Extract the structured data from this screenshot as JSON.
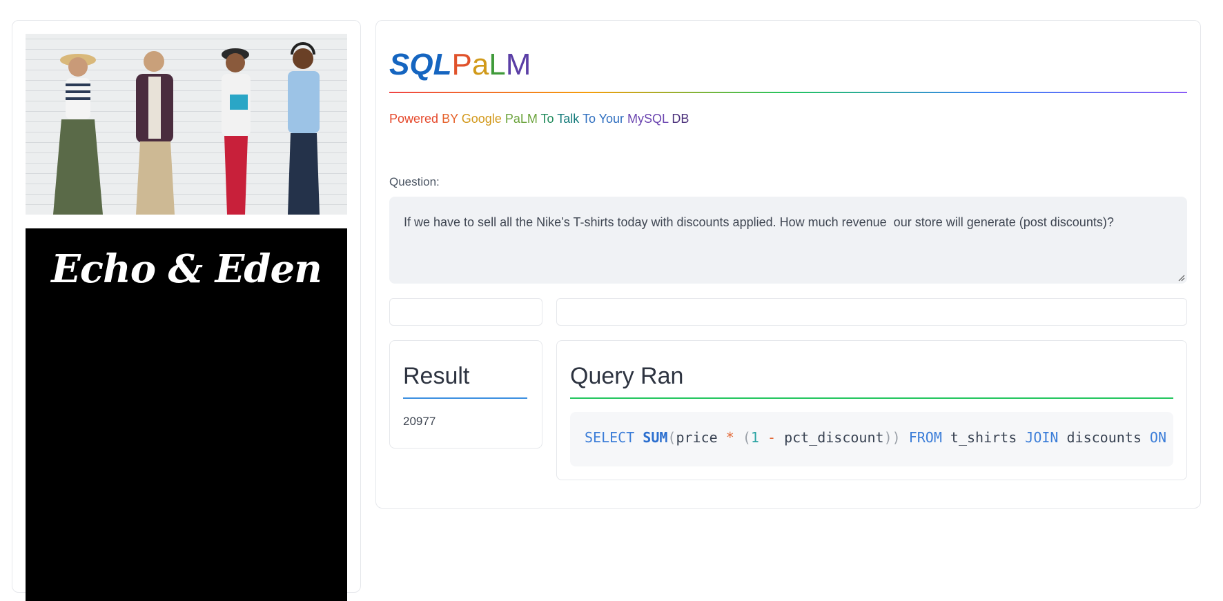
{
  "sidebar": {
    "photo_alt": "group-of-people-with-phones",
    "brand_name": "Echo & Eden"
  },
  "header": {
    "title_part1": "SQL",
    "title_part2_letters": [
      "P",
      "a",
      "L",
      "M"
    ],
    "title_part2_colors": [
      "#e0522b",
      "#d19a1a",
      "#3f9a3a",
      "#5b3fa6"
    ],
    "subtitle_words": [
      "Powered",
      "BY",
      "Google",
      "PaLM",
      "To",
      "Talk",
      "To",
      "Your",
      "MySQL",
      "DB"
    ],
    "subtitle_colors": [
      "#e5482b",
      "#e5622b",
      "#d2981a",
      "#6aa23a",
      "#1f8a5a",
      "#137a7a",
      "#2f6fc0",
      "#2f6fc0",
      "#6b45b0",
      "#4a2f7a"
    ]
  },
  "question": {
    "label": "Question:",
    "value": "If we have to sell all the Nike’s T-shirts today with discounts applied. How much revenue  our store will generate (post discounts)?"
  },
  "result": {
    "heading": "Result",
    "value": "20977"
  },
  "query": {
    "heading": "Query Ran",
    "tokens": [
      {
        "text": "SELECT",
        "kind": "kw"
      },
      {
        "text": " ",
        "kind": ""
      },
      {
        "text": "SUM",
        "kind": "fn"
      },
      {
        "text": "(",
        "kind": "pn"
      },
      {
        "text": "price",
        "kind": ""
      },
      {
        "text": " ",
        "kind": ""
      },
      {
        "text": "*",
        "kind": "op"
      },
      {
        "text": " ",
        "kind": ""
      },
      {
        "text": "(",
        "kind": "pn"
      },
      {
        "text": "1",
        "kind": "num"
      },
      {
        "text": " ",
        "kind": ""
      },
      {
        "text": "-",
        "kind": "op"
      },
      {
        "text": " ",
        "kind": ""
      },
      {
        "text": "pct_discount",
        "kind": ""
      },
      {
        "text": "))",
        "kind": "pn"
      },
      {
        "text": " ",
        "kind": ""
      },
      {
        "text": "FROM",
        "kind": "kw"
      },
      {
        "text": " t_shirts ",
        "kind": ""
      },
      {
        "text": "JOIN",
        "kind": "kw"
      },
      {
        "text": " discounts ",
        "kind": ""
      },
      {
        "text": "ON",
        "kind": "kw"
      }
    ]
  },
  "colors": {
    "accent_blue": "#1565c0",
    "result_underline": "#3b8fe0",
    "query_underline": "#22c55e"
  }
}
